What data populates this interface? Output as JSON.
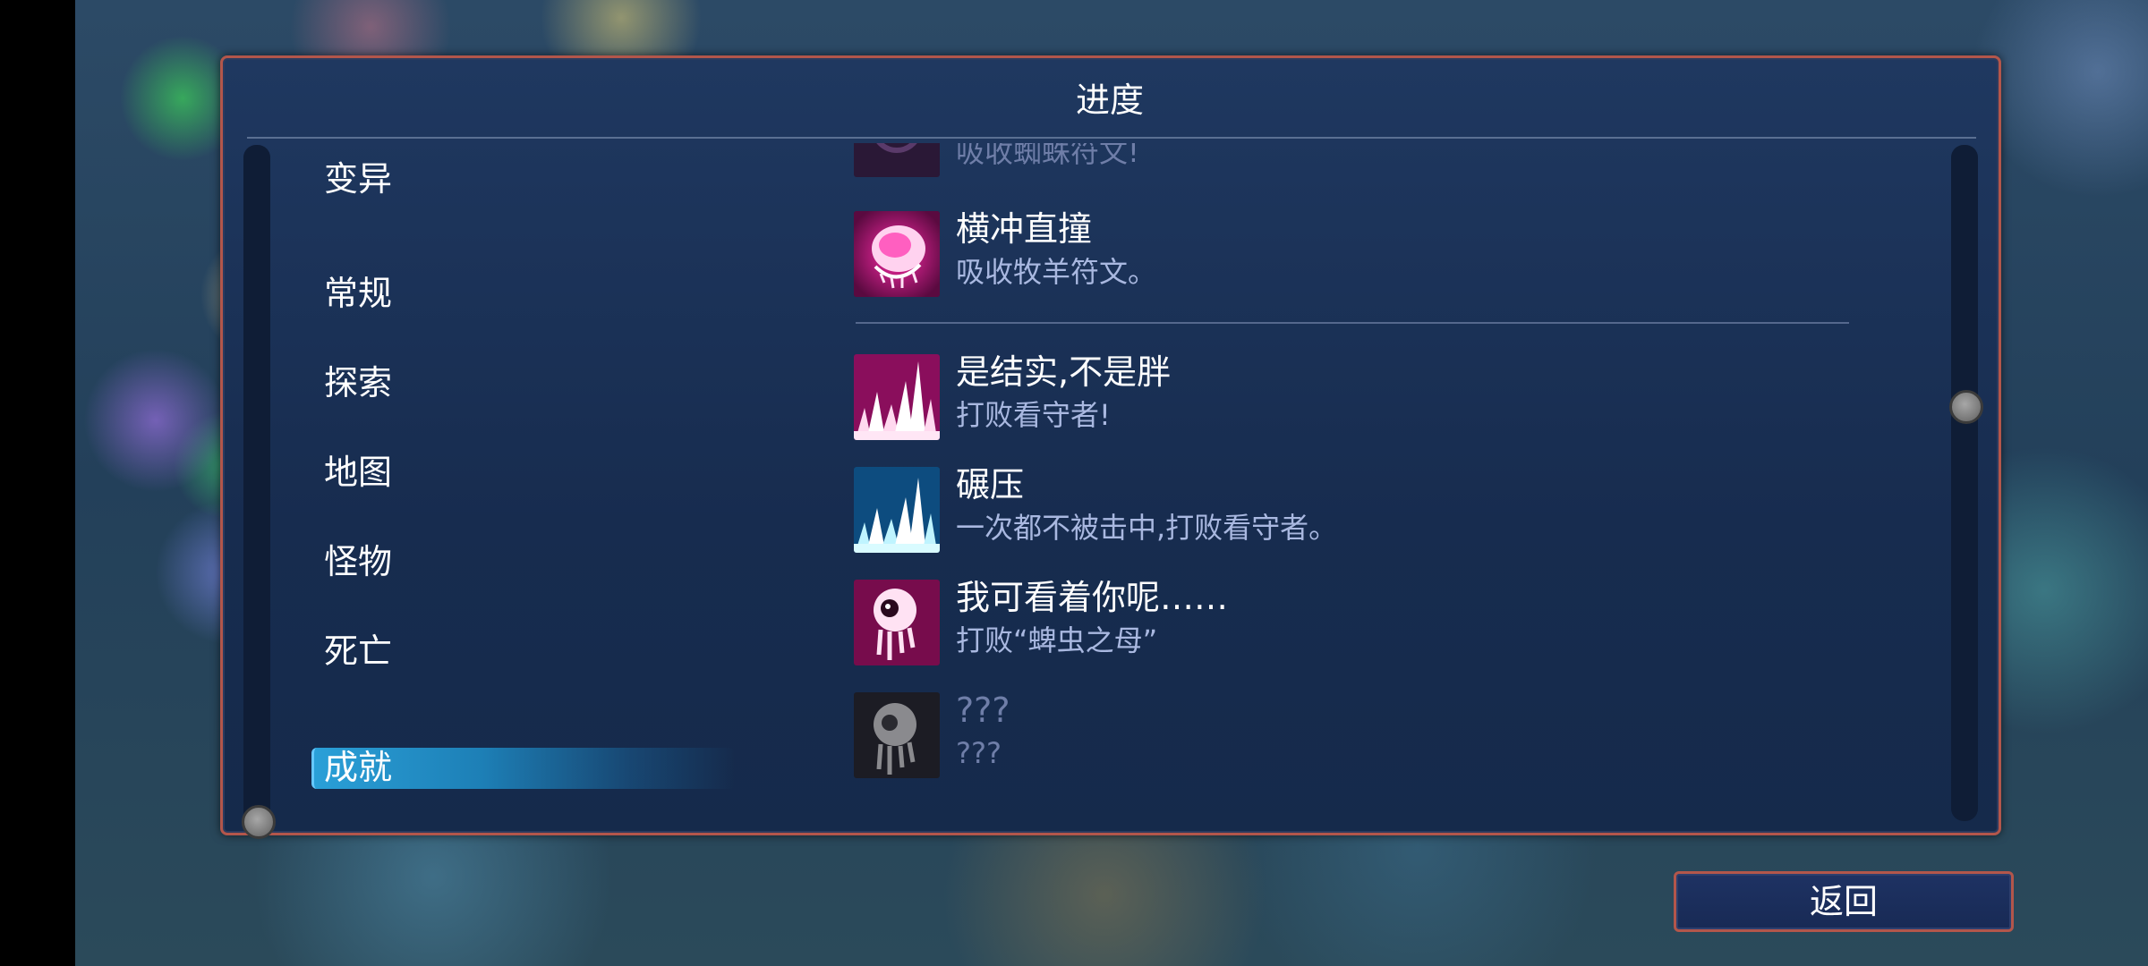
{
  "title": "进度",
  "categories": [
    {
      "label": "变异",
      "active": false
    },
    {
      "label": "常规",
      "active": false
    },
    {
      "label": "探索",
      "active": false
    },
    {
      "label": "地图",
      "active": false
    },
    {
      "label": "怪物",
      "active": false
    },
    {
      "label": "死亡",
      "active": false
    },
    {
      "label": "成就",
      "active": true
    }
  ],
  "achievements": [
    {
      "name": "",
      "desc": "吸收蜘蛛符文!",
      "icon": "spider-rune-icon",
      "state": "partially-visible"
    },
    {
      "name": "横冲直撞",
      "desc": "吸收牧羊符文。",
      "icon": "ram-rune-icon",
      "state": "unlocked"
    },
    {
      "name": "是结实,不是胖",
      "desc": "打败看守者!",
      "icon": "pink-spikes-icon",
      "state": "unlocked"
    },
    {
      "name": "碾压",
      "desc": "一次都不被击中,打败看守者。",
      "icon": "blue-spikes-icon",
      "state": "unlocked"
    },
    {
      "name": "我可看着你呢……",
      "desc": "打败“蜱虫之母”",
      "icon": "pink-eye-creature-icon",
      "state": "unlocked"
    },
    {
      "name": "???",
      "desc": "???",
      "icon": "locked-eye-creature-icon",
      "state": "locked"
    }
  ],
  "back_label": "返回",
  "colors": {
    "panel_bg": "#1b3257",
    "panel_border": "#b3564b",
    "active_tab": "#2aa0d8",
    "desc_text": "#a9b8e0"
  }
}
